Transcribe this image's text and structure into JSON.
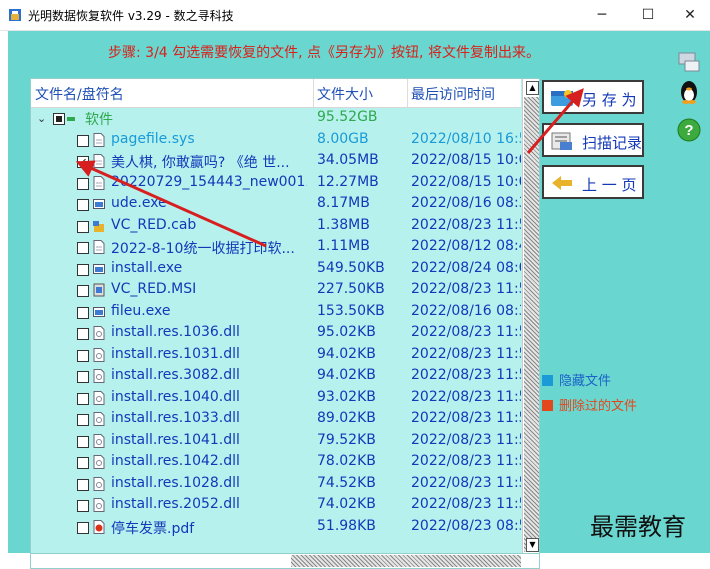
{
  "window": {
    "title": "光明数据恢复软件 v3.29 - 数之寻科技",
    "controls": {
      "minimize": "─",
      "maximize": "☐",
      "close": "✕"
    }
  },
  "step_text": "步骤: 3/4 勾选需要恢复的文件, 点《另存为》按钮, 将文件复制出来。",
  "file_list": {
    "columns": [
      "文件名/盘符名",
      "文件大小",
      "最后访问时间"
    ],
    "rows": [
      {
        "name": "软件",
        "size": "95.52GB",
        "time": "",
        "checkbox": "partial",
        "icon": "folder-icon",
        "color": "#2fa84e"
      },
      {
        "name": "pagefile.sys",
        "size": "8.00GB",
        "time": "2022/08/10 16:5",
        "checkbox": "unchecked",
        "icon": "file-icon",
        "color": "#1a9ad6"
      },
      {
        "name": "美人棋, 你敢赢吗? 《绝 世...",
        "size": "34.05MB",
        "time": "2022/08/15 10:0",
        "checkbox": "checked",
        "icon": "file-icon",
        "color": "#1338b8"
      },
      {
        "name": "20220729_154443_new001...",
        "size": "12.27MB",
        "time": "2022/08/15 10:0",
        "checkbox": "unchecked",
        "icon": "file-icon",
        "color": "#1338b8"
      },
      {
        "name": "ude.exe",
        "size": "8.17MB",
        "time": "2022/08/16 08:3",
        "checkbox": "unchecked",
        "icon": "exe-icon",
        "color": "#1338b8"
      },
      {
        "name": "VC_RED.cab",
        "size": "1.38MB",
        "time": "2022/08/23 11:5",
        "checkbox": "unchecked",
        "icon": "cab-icon",
        "color": "#1338b8"
      },
      {
        "name": "2022-8-10统一收据打印软...",
        "size": "1.11MB",
        "time": "2022/08/12 08:4",
        "checkbox": "unchecked",
        "icon": "file-icon",
        "color": "#1338b8"
      },
      {
        "name": "install.exe",
        "size": "549.50KB",
        "time": "2022/08/24 08:0",
        "checkbox": "unchecked",
        "icon": "exe-icon",
        "color": "#1338b8"
      },
      {
        "name": "VC_RED.MSI",
        "size": "227.50KB",
        "time": "2022/08/23 11:5",
        "checkbox": "unchecked",
        "icon": "msi-icon",
        "color": "#1338b8"
      },
      {
        "name": "fileu.exe",
        "size": "153.50KB",
        "time": "2022/08/16 08:3",
        "checkbox": "unchecked",
        "icon": "exe-icon",
        "color": "#1338b8"
      },
      {
        "name": "install.res.1036.dll",
        "size": "95.02KB",
        "time": "2022/08/23 11:5",
        "checkbox": "unchecked",
        "icon": "dll-icon",
        "color": "#1338b8"
      },
      {
        "name": "install.res.1031.dll",
        "size": "94.02KB",
        "time": "2022/08/23 11:5",
        "checkbox": "unchecked",
        "icon": "dll-icon",
        "color": "#1338b8"
      },
      {
        "name": "install.res.3082.dll",
        "size": "94.02KB",
        "time": "2022/08/23 11:5",
        "checkbox": "unchecked",
        "icon": "dll-icon",
        "color": "#1338b8"
      },
      {
        "name": "install.res.1040.dll",
        "size": "93.02KB",
        "time": "2022/08/23 11:5",
        "checkbox": "unchecked",
        "icon": "dll-icon",
        "color": "#1338b8"
      },
      {
        "name": "install.res.1033.dll",
        "size": "89.02KB",
        "time": "2022/08/23 11:5",
        "checkbox": "unchecked",
        "icon": "dll-icon",
        "color": "#1338b8"
      },
      {
        "name": "install.res.1041.dll",
        "size": "79.52KB",
        "time": "2022/08/23 11:5",
        "checkbox": "unchecked",
        "icon": "dll-icon",
        "color": "#1338b8"
      },
      {
        "name": "install.res.1042.dll",
        "size": "78.02KB",
        "time": "2022/08/23 11:5",
        "checkbox": "unchecked",
        "icon": "dll-icon",
        "color": "#1338b8"
      },
      {
        "name": "install.res.1028.dll",
        "size": "74.52KB",
        "time": "2022/08/23 11:5",
        "checkbox": "unchecked",
        "icon": "dll-icon",
        "color": "#1338b8"
      },
      {
        "name": "install.res.2052.dll",
        "size": "74.02KB",
        "time": "2022/08/23 11:5",
        "checkbox": "unchecked",
        "icon": "dll-icon",
        "color": "#1338b8"
      },
      {
        "name": "停车发票.pdf",
        "size": "51.98KB",
        "time": "2022/08/23 08:5",
        "checkbox": "unchecked",
        "icon": "pdf-icon",
        "color": "#1338b8"
      }
    ]
  },
  "side_buttons": {
    "save_as": "另 存 为",
    "scan_record": "扫描记录",
    "prev_page": "上 一 页"
  },
  "legend": {
    "hidden": {
      "label": "隐藏文件",
      "color": "#1a9ad6"
    },
    "deleted": {
      "label": "删除过的文件",
      "color": "#e2481c"
    }
  },
  "watermark": "最需教育",
  "colors": {
    "accent_red": "#d81f1f",
    "background": "#69d6cf",
    "list_bg": "#b7f1ee",
    "text_blue": "#1338b8"
  }
}
